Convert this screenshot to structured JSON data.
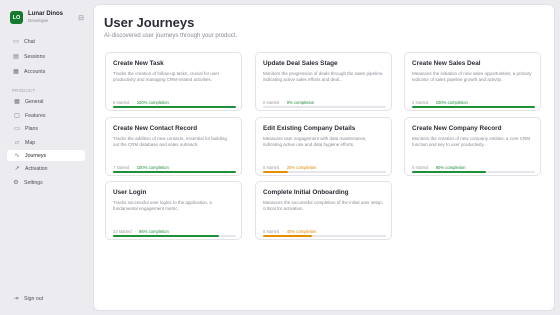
{
  "org": {
    "logo": "LO",
    "name": "Lunar Dinos",
    "plan": "Developer"
  },
  "nav": {
    "chat": "Chat",
    "sessions": "Sessions",
    "accounts": "Accounts",
    "section": "PRODUCT",
    "general": "General",
    "features": "Features",
    "plans": "Plans",
    "map": "Map",
    "journeys": "Journeys",
    "activation": "Activation",
    "settings": "Settings",
    "signout": "Sign out"
  },
  "page": {
    "title": "User Journeys",
    "subtitle": "AI-discovered user journeys through your product."
  },
  "colors": {
    "accent": "#1f8f3a",
    "warning": "#e58e00",
    "brand": "#157a2e"
  },
  "journeys": [
    {
      "title": "Create New Task",
      "desc": "Tracks the creation of follow-up tasks, crucial for user productivity and managing CRM-related activities.",
      "started": "8 started",
      "completion": "100% completion",
      "pct": 100,
      "status": "green"
    },
    {
      "title": "Update Deal Sales Stage",
      "desc": "Monitors the progression of deals through the sales pipeline, indicating active sales efforts and deal...",
      "started": "0 started",
      "completion": "0% completion",
      "pct": 0,
      "status": "green"
    },
    {
      "title": "Create New Sales Deal",
      "desc": "Measures the initiation of new sales opportunities, a primary indicator of sales pipeline growth and activity.",
      "started": "2 started",
      "completion": "100% completion",
      "pct": 100,
      "status": "green"
    },
    {
      "title": "Create New Contact Record",
      "desc": "Tracks the addition of new contacts, essential for building out the CRM database and sales outreach.",
      "started": "7 started",
      "completion": "100% completion",
      "pct": 100,
      "status": "green"
    },
    {
      "title": "Edit Existing Company Details",
      "desc": "Measures user engagement with data maintenance, indicating active use and data hygiene efforts.",
      "started": "5 started",
      "completion": "20% completion",
      "pct": 20,
      "status": "orange"
    },
    {
      "title": "Create New Company Record",
      "desc": "Monitors the creation of new company entities, a core CRM function and key to user productivity.",
      "started": "5 started",
      "completion": "60% completion",
      "pct": 60,
      "status": "green"
    },
    {
      "title": "User Login",
      "desc": "Tracks successful user logins to the application, a fundamental engagement metric.",
      "started": "22 started",
      "completion": "86% completion",
      "pct": 86,
      "status": "green"
    },
    {
      "title": "Complete Initial Onboarding",
      "desc": "Measures the successful completion of the initial user setup, critical for activation.",
      "started": "5 started",
      "completion": "40% completion",
      "pct": 40,
      "status": "orange"
    }
  ]
}
